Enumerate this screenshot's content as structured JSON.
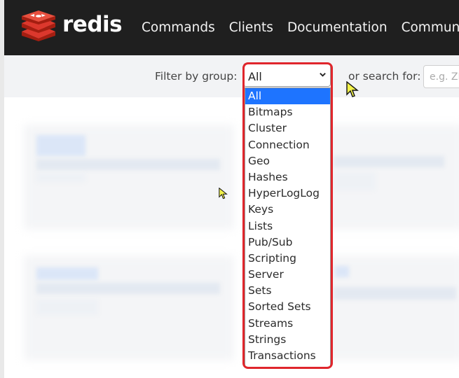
{
  "brand": {
    "name": "redis",
    "logo_icon": "redis-cube-logo",
    "accent": "#dc382d"
  },
  "nav": {
    "links": [
      "Commands",
      "Clients",
      "Documentation",
      "Community"
    ]
  },
  "filter": {
    "label": "Filter by group:",
    "selected": "All",
    "options": [
      "All",
      "Bitmaps",
      "Cluster",
      "Connection",
      "Geo",
      "Hashes",
      "HyperLogLog",
      "Keys",
      "Lists",
      "Pub/Sub",
      "Scripting",
      "Server",
      "Sets",
      "Sorted Sets",
      "Streams",
      "Strings",
      "Transactions"
    ],
    "highlight_color": "#e0262c",
    "selected_bg": "#1e74ff"
  },
  "search": {
    "label": "or search for:",
    "placeholder": "e.g. ZR"
  }
}
